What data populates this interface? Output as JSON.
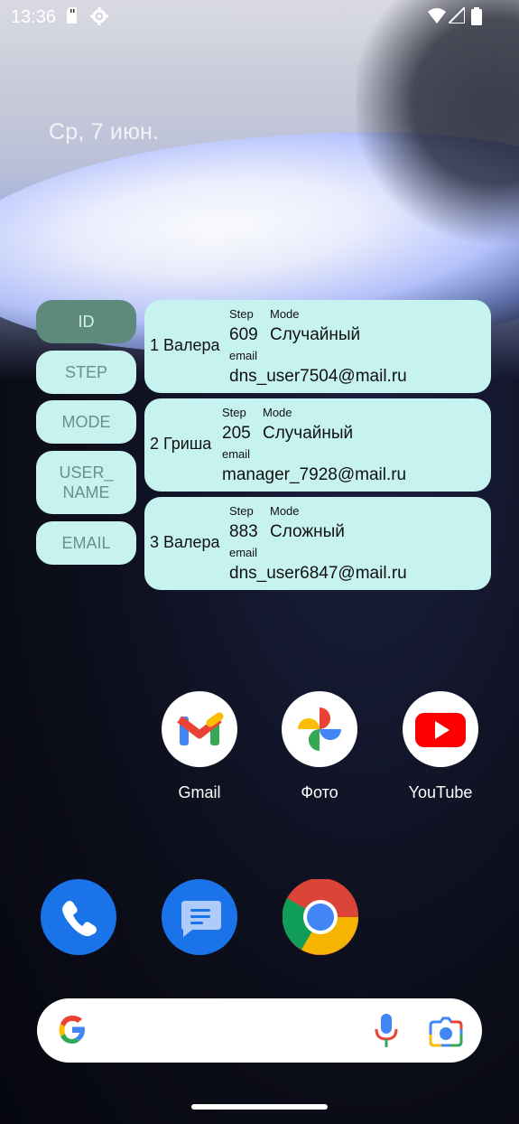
{
  "status": {
    "time": "13:36",
    "icons": [
      "sd-card-icon",
      "settings-icon",
      "wifi-icon",
      "signal-icon",
      "battery-icon"
    ]
  },
  "date": "Ср, 7 июн.",
  "side_buttons": [
    {
      "label": "ID",
      "active": true
    },
    {
      "label": "STEP"
    },
    {
      "label": "MODE"
    },
    {
      "label": "USER_\nNAME"
    },
    {
      "label": "EMAIL"
    }
  ],
  "cards": [
    {
      "id_name": "1 Валера",
      "step_label": "Step",
      "step": "609",
      "mode_label": "Mode",
      "mode": "Случайный",
      "email_label": "email",
      "email": "dns_user7504@mail.ru"
    },
    {
      "id_name": "2 Гриша",
      "step_label": "Step",
      "step": "205",
      "mode_label": "Mode",
      "mode": "Случайный",
      "email_label": "email",
      "email": "manager_7928@mail.ru"
    },
    {
      "id_name": "3 Валера",
      "step_label": "Step",
      "step": "883",
      "mode_label": "Mode",
      "mode": "Сложный",
      "email_label": "email",
      "email": "dns_user6847@mail.ru"
    }
  ],
  "apps": [
    {
      "label": "Gmail",
      "icon": "gmail-icon"
    },
    {
      "label": "Фото",
      "icon": "photos-icon"
    },
    {
      "label": "YouTube",
      "icon": "youtube-icon"
    }
  ],
  "dock": [
    "phone-icon",
    "messages-icon",
    "chrome-icon"
  ],
  "search": {
    "icons": [
      "google-g-icon",
      "mic-icon",
      "lens-icon"
    ]
  },
  "colors": {
    "card_bg": "#c6f2f0",
    "active_button": "#5e8a7e",
    "button_bg": "#c8f2ee"
  }
}
